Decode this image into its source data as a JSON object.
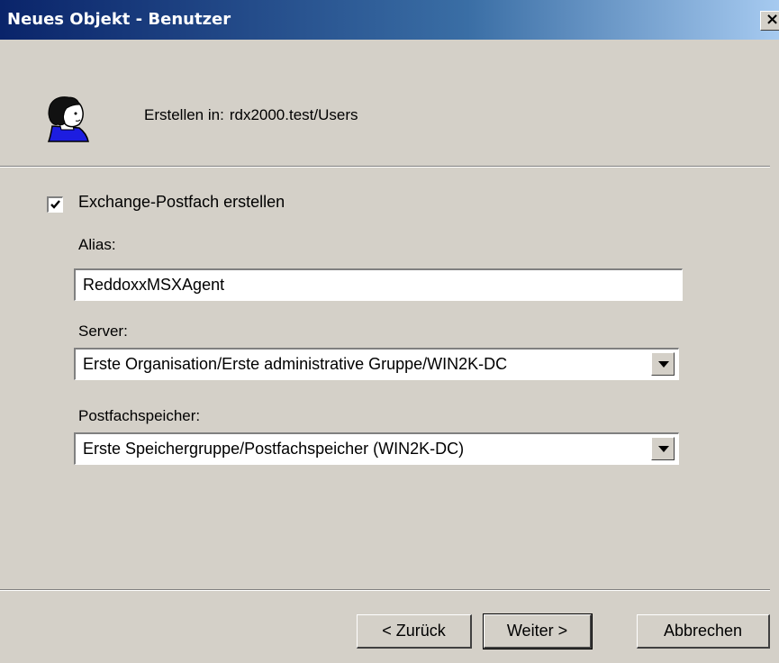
{
  "window": {
    "title": "Neues Objekt - Benutzer",
    "close_glyph": "×"
  },
  "header": {
    "icon": "user-icon",
    "create_in_label": "Erstellen in:",
    "create_in_path": "rdx2000.test/Users"
  },
  "exchange": {
    "checkbox_label": "Exchange-Postfach erstellen",
    "checked": true
  },
  "form": {
    "alias_label": "Alias:",
    "alias_value": "ReddoxxMSXAgent",
    "server_label": "Server:",
    "server_value": "Erste Organisation/Erste administrative Gruppe/WIN2K-DC",
    "store_label": "Postfachspeicher:",
    "store_value": "Erste Speichergruppe/Postfachspeicher (WIN2K-DC)"
  },
  "buttons": {
    "back": "< Zurück",
    "next": "Weiter >",
    "cancel": "Abbrechen"
  },
  "colors": {
    "title_start": "#0a246a",
    "title_end": "#a6caf0",
    "dialog_bg": "#d4d0c8"
  }
}
